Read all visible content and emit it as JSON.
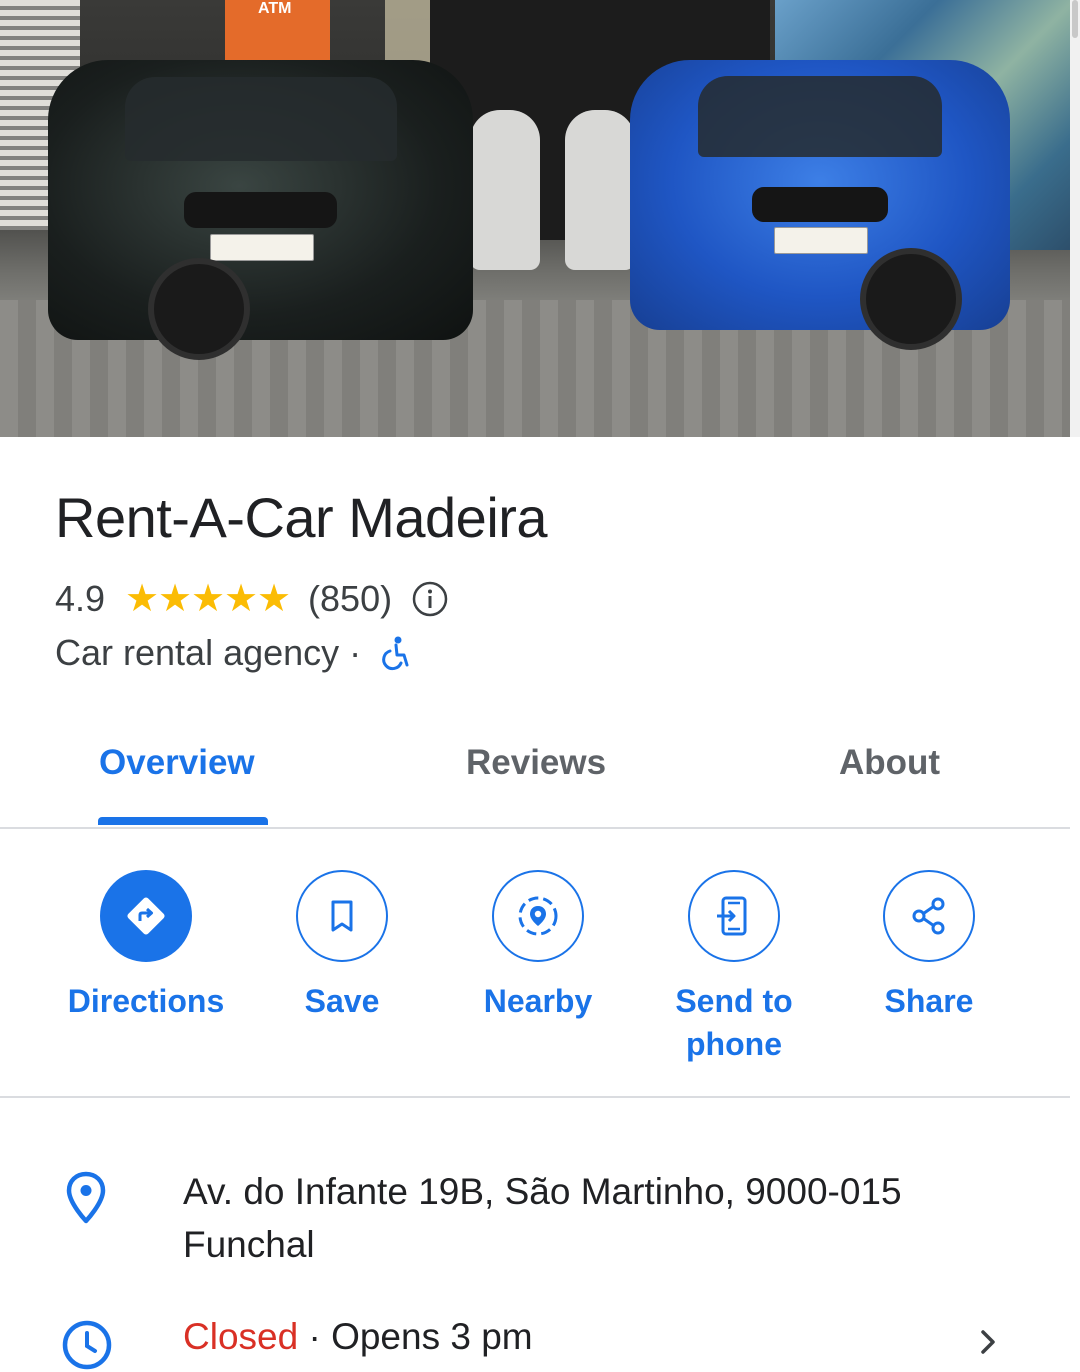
{
  "place": {
    "name": "Rent-A-Car Madeira",
    "rating": "4.9",
    "stars": 5,
    "review_count": "(850)",
    "category": "Car rental agency",
    "separator": "·",
    "hero_sign_text": "ATM"
  },
  "tabs": [
    {
      "label": "Overview",
      "active": true
    },
    {
      "label": "Reviews",
      "active": false
    },
    {
      "label": "About",
      "active": false
    }
  ],
  "actions": [
    {
      "label": "Directions",
      "icon": "directions-icon"
    },
    {
      "label": "Save",
      "icon": "bookmark-icon"
    },
    {
      "label": "Nearby",
      "icon": "nearby-icon"
    },
    {
      "label": "Send to phone",
      "icon": "send-to-phone-icon"
    },
    {
      "label": "Share",
      "icon": "share-icon"
    }
  ],
  "info": {
    "address": "Av. do Infante 19B, São Martinho, 9000-015 Funchal",
    "hours_status": "Closed",
    "hours_separator": " · ",
    "hours_detail": "Opens 3 pm"
  },
  "colors": {
    "accent": "#1a73e8",
    "star": "#fbbc04",
    "closed": "#d93025",
    "text_secondary": "#3c4043"
  }
}
